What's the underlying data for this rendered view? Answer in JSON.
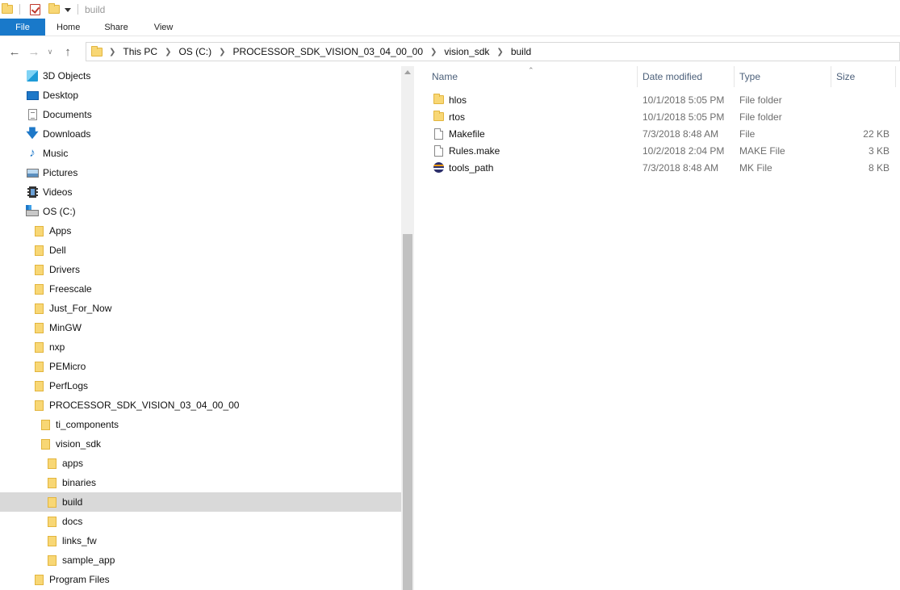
{
  "window": {
    "title": "build"
  },
  "ribbon": {
    "tabs": [
      "File",
      "Home",
      "Share",
      "View"
    ]
  },
  "address": {
    "crumbs": [
      "This PC",
      "OS (C:)",
      "PROCESSOR_SDK_VISION_03_04_00_00",
      "vision_sdk",
      "build"
    ]
  },
  "nav_pane": {
    "items": [
      {
        "label": "3D Objects",
        "icon": "3d-objects-icon",
        "indent": 0
      },
      {
        "label": "Desktop",
        "icon": "desktop-icon",
        "indent": 0
      },
      {
        "label": "Documents",
        "icon": "documents-icon",
        "indent": 0
      },
      {
        "label": "Downloads",
        "icon": "downloads-icon",
        "indent": 0
      },
      {
        "label": "Music",
        "icon": "music-icon",
        "indent": 0
      },
      {
        "label": "Pictures",
        "icon": "pictures-icon",
        "indent": 0
      },
      {
        "label": "Videos",
        "icon": "videos-icon",
        "indent": 0
      },
      {
        "label": "OS (C:)",
        "icon": "drive-icon",
        "indent": 0
      },
      {
        "label": "Apps",
        "icon": "folder-icon",
        "indent": 1
      },
      {
        "label": "Dell",
        "icon": "folder-icon",
        "indent": 1
      },
      {
        "label": "Drivers",
        "icon": "folder-icon",
        "indent": 1
      },
      {
        "label": "Freescale",
        "icon": "folder-icon",
        "indent": 1
      },
      {
        "label": "Just_For_Now",
        "icon": "folder-icon",
        "indent": 1
      },
      {
        "label": "MinGW",
        "icon": "folder-icon",
        "indent": 1
      },
      {
        "label": "nxp",
        "icon": "folder-icon",
        "indent": 1
      },
      {
        "label": "PEMicro",
        "icon": "folder-icon",
        "indent": 1
      },
      {
        "label": "PerfLogs",
        "icon": "folder-icon",
        "indent": 1
      },
      {
        "label": "PROCESSOR_SDK_VISION_03_04_00_00",
        "icon": "folder-icon",
        "indent": 1
      },
      {
        "label": "ti_components",
        "icon": "folder-icon",
        "indent": 2
      },
      {
        "label": "vision_sdk",
        "icon": "folder-icon",
        "indent": 2
      },
      {
        "label": "apps",
        "icon": "folder-icon",
        "indent": 3
      },
      {
        "label": "binaries",
        "icon": "folder-icon",
        "indent": 3
      },
      {
        "label": "build",
        "icon": "folder-icon",
        "indent": 3,
        "selected": true
      },
      {
        "label": "docs",
        "icon": "folder-icon",
        "indent": 3
      },
      {
        "label": "links_fw",
        "icon": "folder-icon",
        "indent": 3
      },
      {
        "label": "sample_app",
        "icon": "folder-icon",
        "indent": 3
      },
      {
        "label": "Program Files",
        "icon": "folder-icon",
        "indent": 1
      }
    ]
  },
  "details": {
    "columns": {
      "name": "Name",
      "date": "Date modified",
      "type": "Type",
      "size": "Size"
    },
    "rows": [
      {
        "name": "hlos",
        "date": "10/1/2018 5:05 PM",
        "type": "File folder",
        "size": "",
        "icon": "folder-icon"
      },
      {
        "name": "rtos",
        "date": "10/1/2018 5:05 PM",
        "type": "File folder",
        "size": "",
        "icon": "folder-icon"
      },
      {
        "name": "Makefile",
        "date": "7/3/2018 8:48 AM",
        "type": "File",
        "size": "22 KB",
        "icon": "file-icon"
      },
      {
        "name": "Rules.make",
        "date": "10/2/2018 2:04 PM",
        "type": "MAKE File",
        "size": "3 KB",
        "icon": "file-icon"
      },
      {
        "name": "tools_path",
        "date": "7/3/2018 8:48 AM",
        "type": "MK File",
        "size": "8 KB",
        "icon": "mk-file-icon"
      }
    ]
  }
}
